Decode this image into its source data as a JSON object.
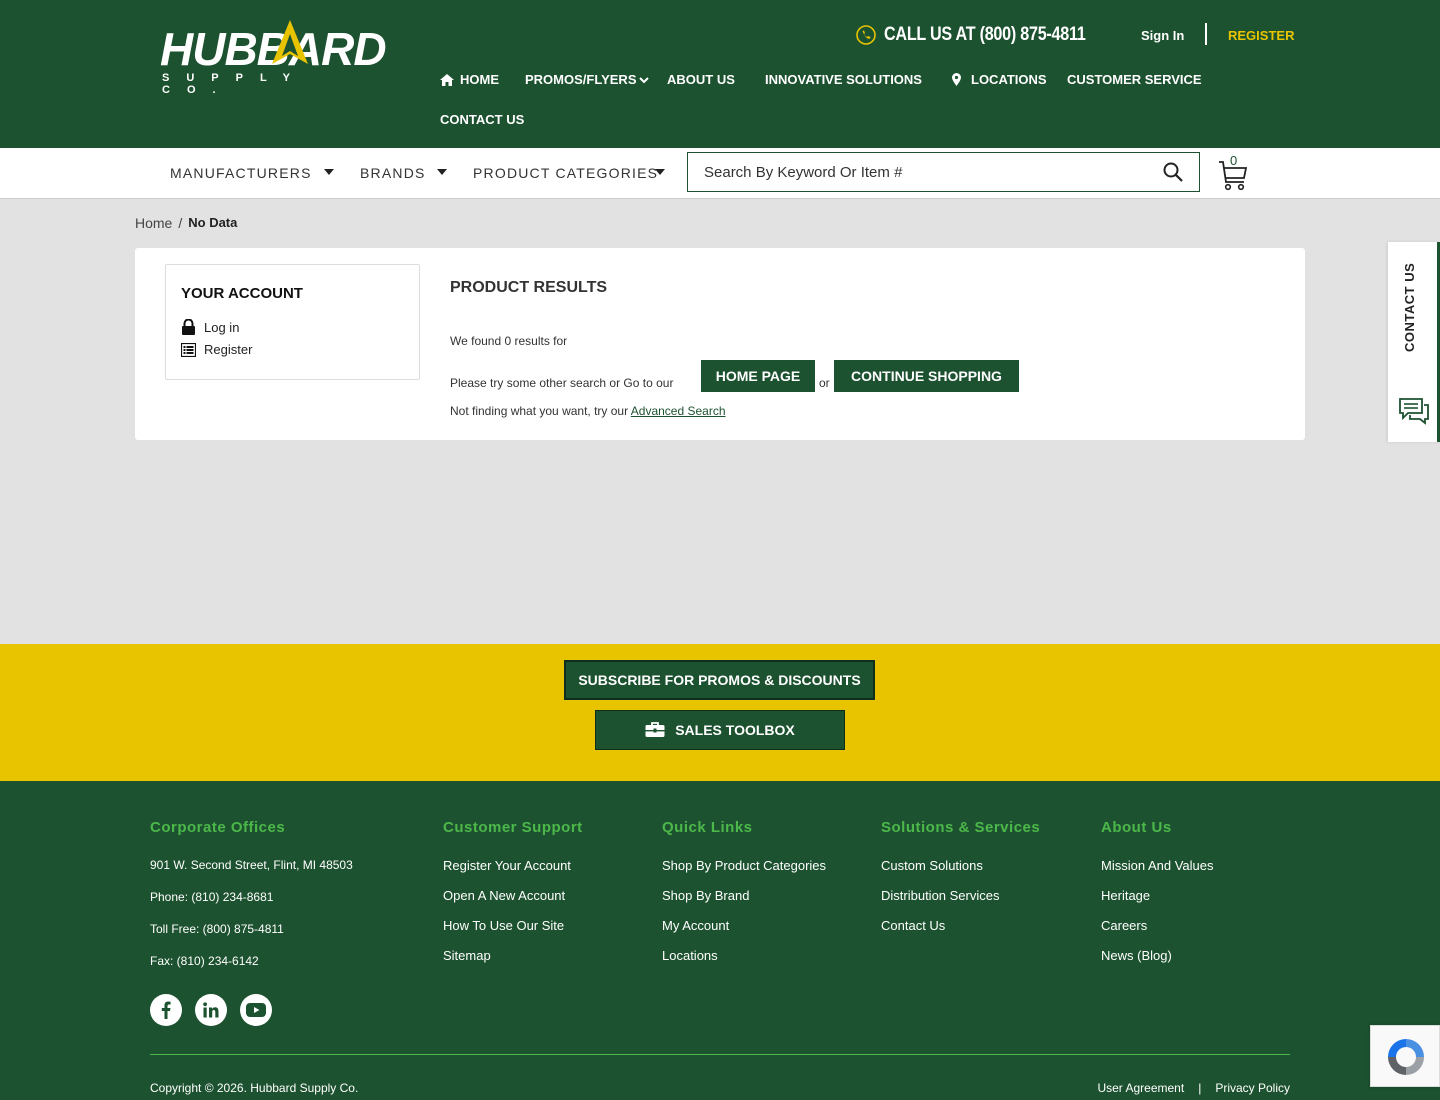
{
  "header": {
    "logo_text": "HUBBARD",
    "logo_sub": "SUPPLY CO.",
    "call_us": "CALL US AT (800) 875-4811",
    "sign_in": "Sign In",
    "register": "REGISTER",
    "nav": {
      "home": "HOME",
      "promos": "PROMOS/FLYERS",
      "about": "ABOUT US",
      "innovative": "INNOVATIVE SOLUTIONS",
      "locations": "LOCATIONS",
      "customer_service": "CUSTOMER SERVICE",
      "contact": "CONTACT US"
    }
  },
  "subnav": {
    "manufacturers": "MANUFACTURERS",
    "brands": "BRANDS",
    "categories": "PRODUCT CATEGORIES",
    "search_placeholder": "Search By Keyword Or Item #",
    "cart_count": "0"
  },
  "breadcrumb": {
    "home": "Home",
    "separator": "/",
    "current": "No Data"
  },
  "account": {
    "title": "YOUR ACCOUNT",
    "login": "Log in",
    "register": "Register"
  },
  "results": {
    "title": "PRODUCT RESULTS",
    "found": "We found 0 results for",
    "try_other": "Please try some other search or Go to our",
    "home_page_btn": "HOME PAGE",
    "or": "or",
    "continue_btn": "CONTINUE SHOPPING",
    "not_finding": "Not finding what you want, try our",
    "advanced_search": "Advanced Search"
  },
  "contact_tab": "CONTACT US",
  "promo": {
    "subscribe": "SUBSCRIBE FOR PROMOS & DISCOUNTS",
    "toolbox": "SALES TOOLBOX"
  },
  "footer": {
    "corporate": {
      "title": "Corporate Offices",
      "address": "901 W. Second Street, Flint, MI 48503",
      "phone": "Phone: (810) 234-8681",
      "toll_free": "Toll Free: (800) 875-4811",
      "fax": "Fax: (810) 234-6142"
    },
    "support": {
      "title": "Customer Support",
      "links": [
        "Register Your Account",
        "Open A New Account",
        "How To Use Our Site",
        "Sitemap"
      ]
    },
    "quick": {
      "title": "Quick Links",
      "links": [
        "Shop By Product Categories",
        "Shop By Brand",
        "My Account",
        "Locations"
      ]
    },
    "solutions": {
      "title": "Solutions & Services",
      "links": [
        "Custom Solutions",
        "Distribution Services",
        "Contact Us"
      ]
    },
    "about": {
      "title": "About Us",
      "links": [
        "Mission And Values",
        "Heritage",
        "Careers",
        "News (Blog)"
      ]
    },
    "copyright": "Copyright © 2026. Hubbard Supply Co.",
    "user_agreement": "User Agreement",
    "sep": "|",
    "privacy": "Privacy Policy"
  },
  "colors": {
    "brand_green": "#1d5230",
    "accent_yellow": "#e8c300",
    "footer_heading": "#4cb84a"
  }
}
